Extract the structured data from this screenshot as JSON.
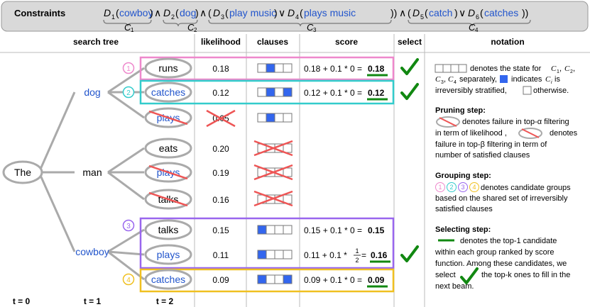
{
  "constraints": {
    "label": "Constraints",
    "d1_var": "D",
    "d1_sub": "1",
    "d1_arg": "cowboy",
    "d2_var": "D",
    "d2_sub": "2",
    "d2_arg": "dog",
    "d3_var": "D",
    "d3_sub": "3",
    "d3_arg": "play music",
    "d4_var": "D",
    "d4_sub": "4",
    "d4_arg": "plays music",
    "d5_var": "D",
    "d5_sub": "5",
    "d5_arg": "catch",
    "d6_var": "D",
    "d6_sub": "6",
    "d6_arg": "catches",
    "and_op": "∧",
    "or_op": "∨",
    "c1": "C",
    "c1_sub": "1",
    "c2": "C",
    "c2_sub": "2",
    "c3": "C",
    "c3_sub": "3",
    "c4": "C",
    "c4_sub": "4"
  },
  "headers": {
    "search_tree": "search tree",
    "likelihood": "likelihood",
    "clauses": "clauses",
    "score": "score",
    "select": "select",
    "notation": "notation"
  },
  "tree": {
    "root": "The",
    "level1": [
      "dog",
      "man",
      "cowboy"
    ],
    "t0": "t = 0",
    "t1": "t = 1",
    "t2": "t = 2"
  },
  "rows": [
    {
      "word": "runs",
      "likelihood": "0.18",
      "score_expr": "0.18 + 0.1 * 0 = ",
      "score_val": "0.18",
      "clauses": [
        0,
        1,
        0,
        0
      ]
    },
    {
      "word": "catches",
      "likelihood": "0.12",
      "score_expr": "0.12 + 0.1 * 0 = ",
      "score_val": "0.12",
      "clauses": [
        0,
        1,
        0,
        1
      ]
    },
    {
      "word": "plays",
      "likelihood": "0.05",
      "score_expr": "",
      "score_val": "",
      "clauses": [
        0,
        1,
        0,
        0
      ]
    },
    {
      "word": "eats",
      "likelihood": "0.20",
      "score_expr": "",
      "score_val": "",
      "clauses": [
        0,
        0,
        0,
        0
      ]
    },
    {
      "word": "plays",
      "likelihood": "0.19",
      "score_expr": "",
      "score_val": "",
      "clauses": [
        0,
        0,
        0,
        0
      ]
    },
    {
      "word": "talks",
      "likelihood": "0.16",
      "score_expr": "",
      "score_val": "",
      "clauses": [
        0,
        0,
        0,
        0
      ]
    },
    {
      "word": "talks",
      "likelihood": "0.15",
      "score_expr": "0.15 + 0.1 * 0 = ",
      "score_val": "0.15",
      "clauses": [
        1,
        0,
        0,
        0
      ]
    },
    {
      "word": "plays",
      "likelihood": "0.11",
      "score_expr": "0.11 + 0.1 * ",
      "frac_num": "1",
      "frac_den": "2",
      "score_tail": " = ",
      "score_val": "0.16",
      "clauses": [
        1,
        0,
        0,
        0
      ]
    },
    {
      "word": "catches",
      "likelihood": "0.09",
      "score_expr": "0.09 + 0.1 * 0 = ",
      "score_val": "0.09",
      "clauses": [
        1,
        0,
        0,
        1
      ]
    }
  ],
  "groups": [
    "1",
    "2",
    "3",
    "4"
  ],
  "notation": {
    "state_text_1": "denotes the state for",
    "state_c1": "C",
    "state_c1_sub": "1",
    "state_c2": "C",
    "state_c2_sub": "2",
    "state_c3": "C",
    "state_c3_sub": "3",
    "state_c4": "C",
    "state_c4_sub": "4",
    "state_separately": "separately,",
    "state_indicates": "indicates",
    "state_ci": "C",
    "state_ci_sub": "i",
    "state_is": "is",
    "state_text_3": "irreversibly stratified,",
    "state_text_4": "otherwise.",
    "pruning_title": "Pruning step:",
    "pruning_l1": "denotes failure in top-α filtering",
    "pruning_l2a": "in term of likelihood ,",
    "pruning_l2b": "denotes",
    "pruning_l3": "failure in top-β filtering in term of",
    "pruning_l4": "number of satisfied clauses",
    "grouping_title": "Grouping step:",
    "grouping_l1": "denotes candidate groups",
    "grouping_l2": "based on the shared set of irreversibly",
    "grouping_l3": "satisfied clauses",
    "selecting_title": "Selecting step:",
    "selecting_l1": "denotes the top-1 candidate",
    "selecting_l2": "within each group ranked by score",
    "selecting_l3": "function. Among these candidates, we",
    "selecting_l4a": "select",
    "selecting_l4b": "the top-k ones to fill in the",
    "selecting_l5": "next beam."
  },
  "colors": {
    "pink": "#ee88cc",
    "cyan": "#33cccc",
    "purple": "#9966ee",
    "yellow": "#f0c020",
    "blue_fill": "#3366ee",
    "green": "#118811",
    "red": "#ee5555",
    "gray": "#999999"
  }
}
